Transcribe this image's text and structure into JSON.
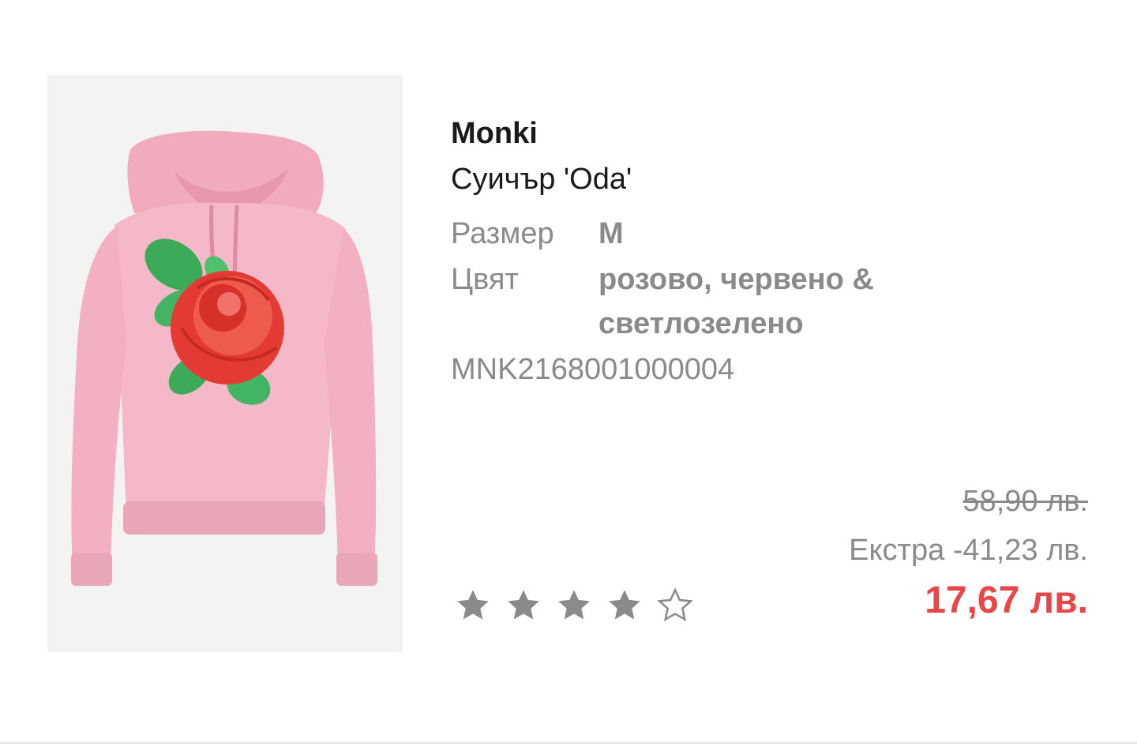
{
  "product": {
    "brand": "Monki",
    "name": "Суичър 'Oda'",
    "image_alt": "pink hoodie with rose print",
    "attributes": [
      {
        "label": "Размер",
        "value": "M"
      },
      {
        "label": "Цвят",
        "value": "розово, червено & светлозелено"
      }
    ],
    "sku": "MNK2168001000004",
    "rating": {
      "value": 4,
      "max": 5
    },
    "price": {
      "original": "58,90 лв.",
      "extra_discount": "Екстра -41,23 лв.",
      "final": "17,67 лв."
    }
  },
  "colors": {
    "final_price": "#e8474a",
    "muted_text": "#8a8a8a",
    "star_filled": "#8a8a8a",
    "image_background": "#f3f3f3",
    "hoodie": "#f4b8c8"
  },
  "icons": {
    "star_filled": "filled-star-icon",
    "star_empty": "empty-star-icon"
  }
}
